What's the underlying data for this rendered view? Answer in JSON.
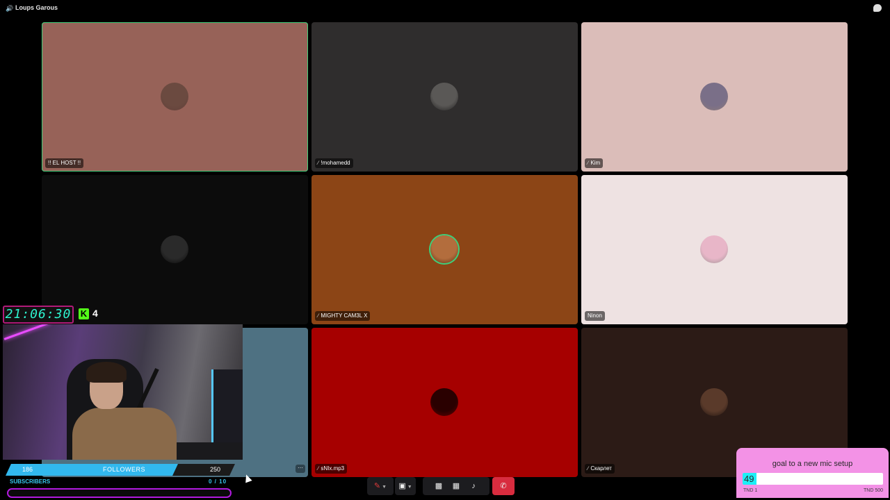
{
  "app": {
    "title": "Loups Garous"
  },
  "tiles": [
    {
      "name": "!! EL HOST !!",
      "muted": false,
      "bg": "#976258",
      "avatar_color": "#6b4a40",
      "speaking": true
    },
    {
      "name": "!mohamedd",
      "muted": true,
      "bg": "#2f2d2d",
      "avatar_color": "#5a5856",
      "speaking": false
    },
    {
      "name": "Kim",
      "muted": true,
      "bg": "#dbbdb9",
      "avatar_color": "#7a6f88",
      "speaking": false
    },
    {
      "name": "",
      "muted": false,
      "bg": "#0c0c0c",
      "avatar_color": "#2a2a2a",
      "speaking": false
    },
    {
      "name": "MIGHTY CAM3L X",
      "muted": true,
      "bg": "#8c4516",
      "avatar_color": "#b36d3d",
      "speaking": true
    },
    {
      "name": "Ninon",
      "muted": false,
      "bg": "#eee2e2",
      "avatar_color": "#e8b6c8",
      "speaking": false
    },
    {
      "name": "",
      "muted": false,
      "bg": "#4e7182",
      "avatar_color": "#4e7182",
      "speaking": false
    },
    {
      "name": "sNIx.mp3",
      "muted": true,
      "bg": "#a60000",
      "avatar_color": "#2a0000",
      "speaking": false
    },
    {
      "name": "Скарлет",
      "muted": true,
      "bg": "#2c1b16",
      "avatar_color": "#5a3a2a",
      "speaking": false
    }
  ],
  "overlay": {
    "clock": "21:06:30",
    "kick_icon": "K",
    "kick_count": "4",
    "followers": {
      "current": "186",
      "label": "FOLLOWERS",
      "goal": "250",
      "progress": 0.744
    },
    "subscribers": {
      "label": "SUBSCRIBERS",
      "count": "0 / 10",
      "progress": 0
    },
    "donation_goal": {
      "title": "goal to a new mic setup",
      "current": "49",
      "start": "TND 1",
      "end": "TND 500",
      "progress": 0.098
    }
  },
  "controls": {
    "mic_icon": "mic-muted-icon",
    "camera_icon": "camera-off-icon",
    "screen_share_icon": "screen-share-icon",
    "activities_icon": "grid-icon",
    "soundboard_icon": "soundboard-icon",
    "more_icon": "more-dots-icon",
    "leave_icon": "phone-hangup-icon"
  },
  "colors": {
    "speaking_ring": "#3fcf7a",
    "leave_red": "#d82c3f",
    "followers_blue": "#32b8ee",
    "subs_purple": "#b21ae0",
    "goal_pink": "#f392e6",
    "goal_cyan": "#1df0f7"
  }
}
